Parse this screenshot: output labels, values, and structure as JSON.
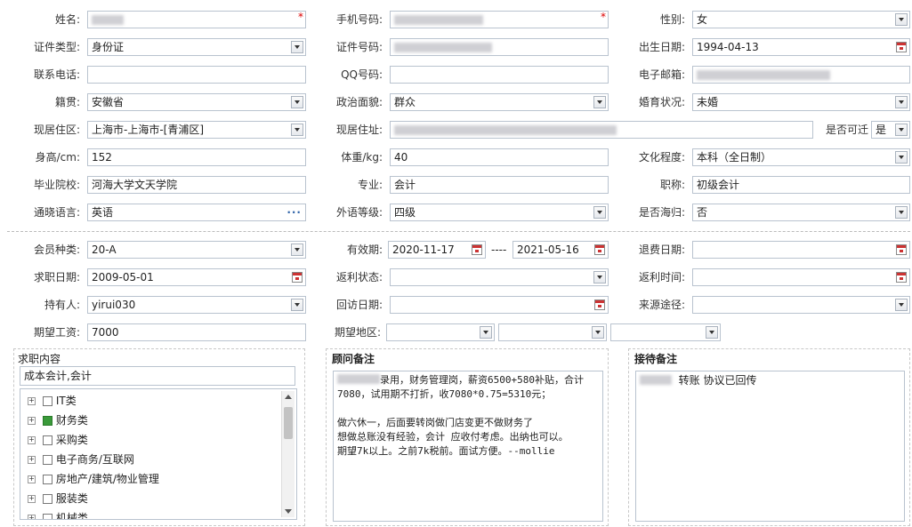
{
  "r1": {
    "name_label": "姓名:",
    "phone_label": "手机号码:",
    "gender_label": "性别:",
    "gender_value": "女"
  },
  "r2": {
    "idtype_label": "证件类型:",
    "idtype_value": "身份证",
    "idno_label": "证件号码:",
    "birth_label": "出生日期:",
    "birth_value": "1994-04-13"
  },
  "r3": {
    "tel_label": "联系电话:",
    "qq_label": "QQ号码:",
    "email_label": "电子邮箱:"
  },
  "r4": {
    "native_label": "籍贯:",
    "native_value": "安徽省",
    "politic_label": "政治面貌:",
    "politic_value": "群众",
    "marital_label": "婚育状况:",
    "marital_value": "未婚"
  },
  "r5": {
    "area_label": "现居住区:",
    "area_value": "上海市-上海市-[青浦区]",
    "addr_label": "现居住址:",
    "move_label": "是否可迁",
    "move_value": "是"
  },
  "r6": {
    "height_label": "身高/cm:",
    "height_value": "152",
    "weight_label": "体重/kg:",
    "weight_value": "40",
    "edu_label": "文化程度:",
    "edu_value": "本科（全日制）"
  },
  "r7": {
    "school_label": "毕业院校:",
    "school_value": "河海大学文天学院",
    "major_label": "专业:",
    "major_value": "会计",
    "title_label": "职称:",
    "title_value": "初级会计"
  },
  "r8": {
    "lang_label": "通晓语言:",
    "lang_value": "英语",
    "level_label": "外语等级:",
    "level_value": "四级",
    "abroad_label": "是否海归:",
    "abroad_value": "否"
  },
  "r9": {
    "member_label": "会员种类:",
    "member_value": "20-A",
    "valid_label": "有效期:",
    "valid_from": "2020-11-17",
    "valid_sep": "----",
    "valid_to": "2021-05-16",
    "refund_label": "退费日期:"
  },
  "r10": {
    "job_date_label": "求职日期:",
    "job_date_value": "2009-05-01",
    "rebate_status_label": "返利状态:",
    "rebate_time_label": "返利时间:"
  },
  "r11": {
    "holder_label": "持有人:",
    "holder_value": "yirui030",
    "visit_label": "回访日期:",
    "source_label": "来源途径:"
  },
  "r12": {
    "salary_label": "期望工资:",
    "salary_value": "7000",
    "region_label": "期望地区:"
  },
  "job_panel": {
    "title": "求职内容",
    "selected": "成本会计,会计",
    "items": [
      {
        "label": "IT类",
        "checked": false
      },
      {
        "label": "财务类",
        "checked": true
      },
      {
        "label": "采购类",
        "checked": false
      },
      {
        "label": "电子商务/互联网",
        "checked": false
      },
      {
        "label": "房地产/建筑/物业管理",
        "checked": false
      },
      {
        "label": "服装类",
        "checked": false
      },
      {
        "label": "机械类",
        "checked": false
      }
    ]
  },
  "advisor_panel": {
    "title": "顾问备注",
    "text": "录用，财务管理岗，薪资6500+580补贴，合计7080，试用期不打折，收7080*0.75=5310元；\n\n做六休一，后面要转岗做门店变更不做财务了\n想做总账没有经验，会计 应收付考虑。出纳也可以。\n期望7k以上。之前7k税前。面试方便。--mollie"
  },
  "reception_panel": {
    "title": "接待备注",
    "text": "转账 协议已回传"
  }
}
